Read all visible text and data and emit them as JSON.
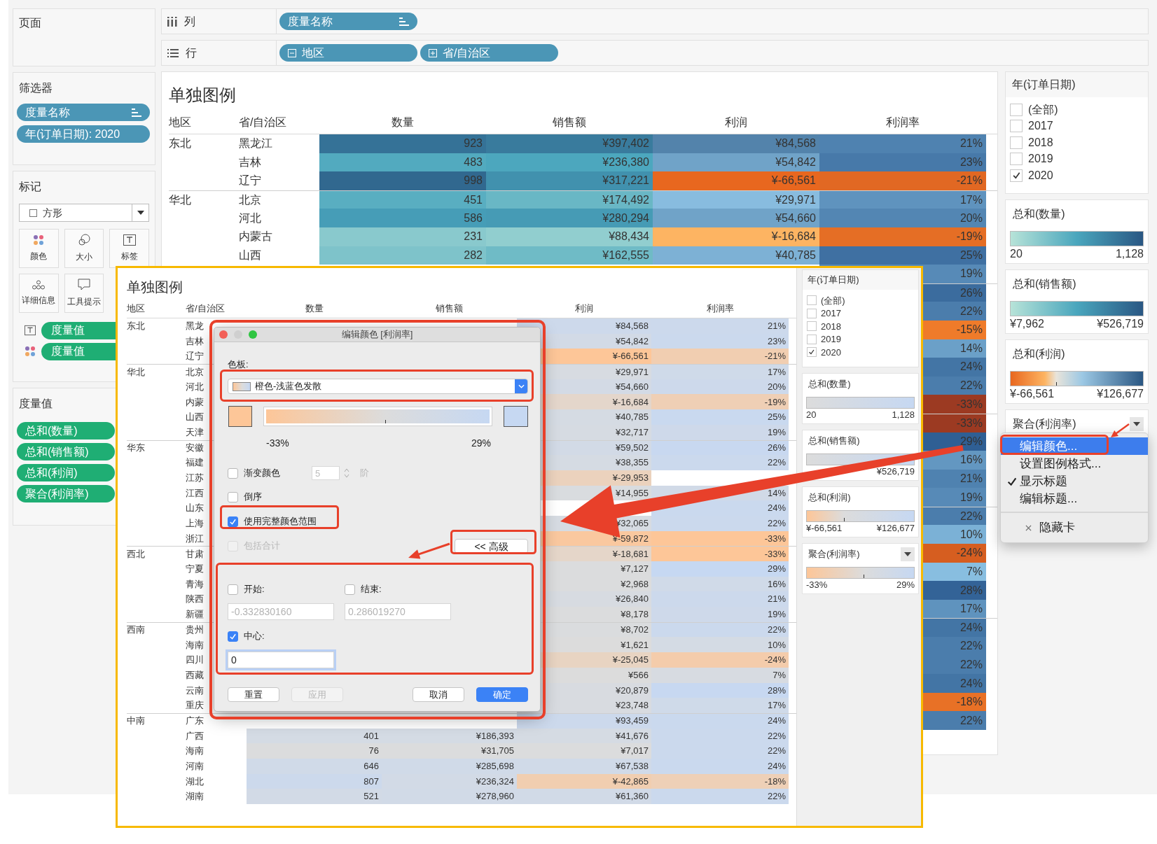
{
  "pages_card": {
    "title": "页面"
  },
  "shelves": [
    {
      "kind": "columns",
      "label": "列",
      "pills": [
        {
          "label": "度量名称",
          "kind": "sort"
        }
      ]
    },
    {
      "kind": "rows",
      "label": "行",
      "pills": [
        {
          "label": "地区",
          "kind": "collapse"
        },
        {
          "label": "省/自治区",
          "kind": "expand"
        }
      ]
    }
  ],
  "filters_card": {
    "title": "筛选器",
    "pills": [
      {
        "label": "度量名称",
        "kind": "sort"
      },
      {
        "label": "年(订单日期): 2020",
        "kind": "plain"
      }
    ]
  },
  "marks_card": {
    "title": "标记",
    "mark_type": "方形",
    "cards": [
      {
        "label": "颜色",
        "kind": "color"
      },
      {
        "label": "大小",
        "kind": "size"
      },
      {
        "label": "标签",
        "kind": "label"
      },
      {
        "label": "详细信息",
        "kind": "detail"
      },
      {
        "label": "工具提示",
        "kind": "tooltip"
      }
    ],
    "fields": [
      {
        "label": "度量值",
        "kind": "label"
      },
      {
        "label": "度量值",
        "kind": "color"
      }
    ]
  },
  "measure_values_card": {
    "title": "度量值",
    "pills": [
      "总和(数量)",
      "总和(销售额)",
      "总和(利润)",
      "聚合(利润率)"
    ]
  },
  "view": {
    "title": "单独图例",
    "columns": [
      "地区",
      "省/自治区",
      "数量",
      "销售额",
      "利润",
      "利润率"
    ],
    "groups": [
      {
        "region": "东北",
        "rows": [
          {
            "province": "黑龙江",
            "quantity": "923",
            "sales": "¥397,402",
            "profit": "¥84,568",
            "rate": "21%"
          },
          {
            "province": "吉林",
            "quantity": "483",
            "sales": "¥236,380",
            "profit": "¥54,842",
            "rate": "23%"
          },
          {
            "province": "辽宁",
            "quantity": "998",
            "sales": "¥317,221",
            "profit": "¥-66,561",
            "rate": "-21%"
          }
        ]
      },
      {
        "region": "华北",
        "rows": [
          {
            "province": "北京",
            "quantity": "451",
            "sales": "¥174,492",
            "profit": "¥29,971",
            "rate": "17%"
          },
          {
            "province": "河北",
            "quantity": "586",
            "sales": "¥280,294",
            "profit": "¥54,660",
            "rate": "20%"
          },
          {
            "province": "内蒙古",
            "quantity": "231",
            "sales": "¥88,434",
            "profit": "¥-16,684",
            "rate": "-19%"
          },
          {
            "province": "山西",
            "quantity": "282",
            "sales": "¥162,555",
            "profit": "¥40,785",
            "rate": "25%"
          },
          {
            "rate": "19%"
          }
        ]
      },
      {
        "rows": [
          {
            "rate": "26%"
          },
          {
            "rate": "22%"
          },
          {
            "rate": "-15%"
          },
          {
            "rate": "14%"
          },
          {
            "rate": "24%"
          },
          {
            "rate": "22%"
          },
          {
            "rate": "-33%"
          }
        ]
      },
      {
        "rows": [
          {
            "rate": "-33%"
          },
          {
            "rate": "29%"
          },
          {
            "rate": "16%"
          },
          {
            "rate": "21%"
          },
          {
            "rate": "19%"
          }
        ]
      },
      {
        "rows": [
          {
            "rate": "22%"
          },
          {
            "rate": "10%"
          },
          {
            "rate": "-24%"
          },
          {
            "rate": "7%"
          },
          {
            "rate": "28%"
          },
          {
            "rate": "17%"
          }
        ]
      },
      {
        "rows": [
          {
            "rate": "24%"
          },
          {
            "rate": "22%"
          },
          {
            "rate": "22%"
          },
          {
            "rate": "24%"
          },
          {
            "rate": "-18%"
          },
          {
            "rate": "22%"
          }
        ]
      }
    ]
  },
  "legends_panel": {
    "filter": {
      "title": "年(订单日期)",
      "items": [
        {
          "label": "(全部)",
          "checked": false
        },
        {
          "label": "2017",
          "checked": false
        },
        {
          "label": "2018",
          "checked": false
        },
        {
          "label": "2019",
          "checked": false
        },
        {
          "label": "2020",
          "checked": true
        }
      ]
    },
    "legends": [
      {
        "title": "总和(数量)",
        "kind": "sequential",
        "min": "20",
        "max": "1,128"
      },
      {
        "title": "总和(销售额)",
        "kind": "sequential",
        "min": "¥7,962",
        "max": "¥526,719"
      },
      {
        "title": "总和(利润)",
        "kind": "diverging",
        "min": "¥-66,561",
        "max": "¥126,677"
      },
      {
        "title": "聚合(利润率)",
        "menu_button": true
      }
    ]
  },
  "legend_menu": {
    "items": [
      {
        "label": "编辑颜色...",
        "kind": "item",
        "selected": true,
        "checked": false
      },
      {
        "label": "设置图例格式...",
        "kind": "item",
        "selected": false,
        "checked": false
      },
      {
        "label": "显示标题",
        "kind": "item",
        "selected": false,
        "checked": true
      },
      {
        "label": "编辑标题...",
        "kind": "item",
        "selected": false,
        "checked": false
      },
      {
        "label": "隐藏卡",
        "kind": "close",
        "selected": false,
        "checked": false
      }
    ]
  },
  "inset": {
    "view": {
      "title": "单独图例",
      "columns": [
        "地区",
        "省/自治区",
        "数量",
        "销售额",
        "利润",
        "利润率"
      ],
      "groups": [
        {
          "region": "东北",
          "rows": [
            {
              "province": "黑龙",
              "profit": "¥84,568",
              "rate": "21%"
            },
            {
              "province": "吉林",
              "profit": "¥54,842",
              "rate": "23%"
            },
            {
              "province": "辽宁",
              "profit": "¥-66,561",
              "rate": "-21%"
            }
          ]
        },
        {
          "region": "华北",
          "rows": [
            {
              "province": "北京",
              "profit": "¥29,971",
              "rate": "17%"
            },
            {
              "province": "河北",
              "profit": "¥54,660",
              "rate": "20%"
            },
            {
              "province": "内蒙",
              "profit": "¥-16,684",
              "rate": "-19%"
            },
            {
              "province": "山西",
              "profit": "¥40,785",
              "rate": "25%"
            },
            {
              "province": "天津",
              "profit": "¥32,717",
              "rate": "19%"
            }
          ]
        },
        {
          "region": "华东",
          "rows": [
            {
              "province": "安徽",
              "profit": "¥59,502",
              "rate": "26%"
            },
            {
              "province": "福建",
              "profit": "¥38,355",
              "rate": "22%"
            },
            {
              "province": "江苏",
              "profit": "¥-29,953"
            },
            {
              "province": "江西",
              "profit": "¥14,955",
              "rate": "14%"
            },
            {
              "province": "山东",
              "rate": "24%"
            },
            {
              "province": "上海",
              "profit": "¥32,065",
              "rate": "22%"
            },
            {
              "province": "浙江",
              "profit": "¥-59,872",
              "rate": "-33%"
            }
          ]
        },
        {
          "region": "西北",
          "rows": [
            {
              "province": "甘肃",
              "profit": "¥-18,681",
              "rate": "-33%"
            },
            {
              "province": "宁夏",
              "profit": "¥7,127",
              "rate": "29%"
            },
            {
              "province": "青海",
              "profit": "¥2,968",
              "rate": "16%"
            },
            {
              "province": "陕西",
              "profit": "¥26,840",
              "rate": "21%"
            },
            {
              "province": "新疆",
              "profit": "¥8,178",
              "rate": "19%"
            }
          ]
        },
        {
          "region": "西南",
          "rows": [
            {
              "province": "贵州",
              "profit": "¥8,702",
              "rate": "22%"
            },
            {
              "province": "海南",
              "profit": "¥1,621",
              "rate": "10%"
            },
            {
              "province": "四川",
              "profit": "¥-25,045",
              "rate": "-24%"
            },
            {
              "province": "西藏",
              "profit": "¥566",
              "rate": "7%"
            },
            {
              "province": "云南",
              "profit": "¥20,879",
              "rate": "28%"
            },
            {
              "province": "重庆",
              "profit": "¥23,748",
              "rate": "17%"
            }
          ]
        },
        {
          "region": "中南",
          "rows": [
            {
              "province": "广东",
              "profit": "¥93,459",
              "rate": "24%"
            },
            {
              "province": "广西",
              "quantity": "401",
              "sales": "¥186,393",
              "profit": "¥41,676",
              "rate": "22%"
            },
            {
              "province": "海南",
              "quantity": "76",
              "sales": "¥31,705",
              "profit": "¥7,017",
              "rate": "22%"
            },
            {
              "province": "河南",
              "quantity": "646",
              "sales": "¥285,698",
              "profit": "¥67,538",
              "rate": "24%"
            },
            {
              "province": "湖北",
              "quantity": "807",
              "sales": "¥236,324",
              "profit": "¥-42,865",
              "rate": "-18%"
            },
            {
              "province": "湖南",
              "quantity": "521",
              "sales": "¥278,960",
              "profit": "¥61,360",
              "rate": "22%"
            }
          ]
        }
      ]
    },
    "legends_panel": {
      "filter": {
        "title": "年(订单日期)",
        "items": [
          {
            "label": "(全部)",
            "checked": false
          },
          {
            "label": "2017",
            "checked": false
          },
          {
            "label": "2018",
            "checked": false
          },
          {
            "label": "2019",
            "checked": false
          },
          {
            "label": "2020",
            "checked": true
          }
        ]
      },
      "legends": [
        {
          "title": "总和(数量)",
          "kind": "sequential",
          "min": "20",
          "max": "1,128"
        },
        {
          "title": "总和(销售额)",
          "kind": "sequential",
          "max": "¥526,719"
        },
        {
          "title": "总和(利润)",
          "kind": "diverging",
          "min": "¥-66,561",
          "max": "¥126,677"
        },
        {
          "title": "聚合(利润率)",
          "kind": "diverging",
          "min": "-33%",
          "max": "29%",
          "menu_button": true
        }
      ]
    }
  },
  "dialog": {
    "title": "编辑颜色 [利润率]",
    "palette_label": "色板:",
    "palette": "橙色-浅蓝色发散",
    "range_min": "-33%",
    "range_max": "29%",
    "options": [
      {
        "label": "渐变颜色",
        "kind": "stepped",
        "checked": false,
        "disabled": false,
        "steps": "5",
        "unit": "阶"
      },
      {
        "label": "倒序",
        "kind": "plain",
        "checked": false,
        "disabled": false
      },
      {
        "label": "使用完整颜色范围",
        "kind": "plain",
        "checked": true,
        "disabled": false
      },
      {
        "label": "包括合计",
        "kind": "plain",
        "checked": false,
        "disabled": true
      }
    ],
    "advanced_button": "<< 高级",
    "range": [
      {
        "label": "开始:",
        "checked": false,
        "value": "-0.332830160"
      },
      {
        "label": "结束:",
        "checked": false,
        "value": "0.286019270"
      }
    ],
    "center": {
      "label": "中心:",
      "checked": true,
      "value": "0"
    },
    "buttons": [
      {
        "label": "重置",
        "kind": "normal",
        "disabled": false
      },
      {
        "label": "应用",
        "kind": "normal",
        "disabled": true
      },
      {
        "label": "取消",
        "kind": "normal",
        "disabled": false
      },
      {
        "label": "确定",
        "kind": "default",
        "disabled": false
      }
    ]
  }
}
